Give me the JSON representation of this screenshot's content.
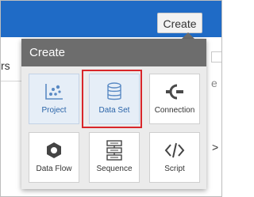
{
  "header": {
    "create_button_label": "Create"
  },
  "background": {
    "left_fragment": "rs",
    "right_fragment_a": "e",
    "right_fragment_b": ">"
  },
  "menu": {
    "title": "Create",
    "items": [
      {
        "label": "Project",
        "icon": "scatter-chart-icon"
      },
      {
        "label": "Data Set",
        "icon": "database-icon",
        "highlighted": true
      },
      {
        "label": "Connection",
        "icon": "plug-icon"
      },
      {
        "label": "Data Flow",
        "icon": "dataflow-hexagon-icon"
      },
      {
        "label": "Sequence",
        "icon": "sequence-list-icon"
      },
      {
        "label": "Script",
        "icon": "code-brackets-icon"
      }
    ]
  },
  "colors": {
    "topbar": "#1f6bc6",
    "panel_header": "#6d6d6d",
    "highlight_border": "#d9262a",
    "selected_tile_text": "#2a64a8"
  }
}
